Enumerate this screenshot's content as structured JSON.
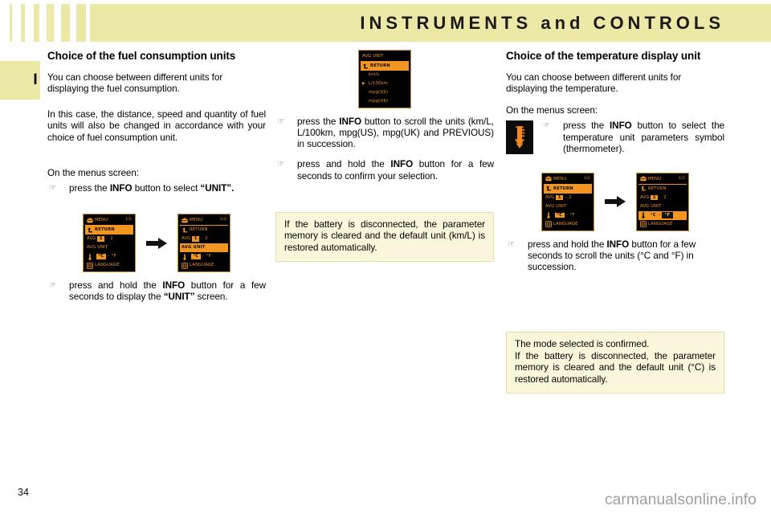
{
  "header": {
    "title": "INSTRUMENTS and CONTROLS",
    "tab_letter": "I",
    "stripe_color": "#ece8a6"
  },
  "left_column": {
    "section_title": "Choice of the fuel consumption units",
    "para_1": "You can choose between different units for displaying the fuel consumption.",
    "para_2": "In this case, the distance, speed and quantity of fuel units will also be changed in accordance with your choice of fuel consumption unit.",
    "para_3": "On the menus screen:",
    "bullet_1": {
      "hand": "☞",
      "text_before": "press the ",
      "bold_1": "INFO",
      "text_mid": " button to select ",
      "bold_2": "“UNIT”.",
      "text_after": ""
    },
    "bullet_2": {
      "hand": "☞",
      "text_before": "press and hold the ",
      "bold_1": "INFO",
      "text_mid": " button for a few seconds to display the ",
      "bold_2": "“UNIT”",
      "text_after": " screen."
    },
    "screen_a": {
      "title": "MENU",
      "page": "1/2",
      "rows": [
        {
          "label": "RETURN",
          "icon": "return-arrow-icon",
          "highlight": true
        },
        {
          "label": "AVG",
          "box": "1",
          "sep": "-",
          "after": "2",
          "highlight": false
        },
        {
          "label": "AVG UNIT",
          "highlight": false
        },
        {
          "label": "",
          "icon": "thermometer-icon",
          "box": "°C",
          "sep": "-",
          "after": "°F",
          "highlight": false
        },
        {
          "label": "LANGUAGE",
          "icon": "globe-icon",
          "highlight": false
        }
      ]
    },
    "screen_b": {
      "title": "MENU",
      "page": "1/2",
      "rows": [
        {
          "label": "RETURN",
          "icon": "return-arrow-icon",
          "highlight": false
        },
        {
          "label": "AVG",
          "box": "1",
          "sep": "-",
          "after": "2",
          "highlight": false
        },
        {
          "label": "AVG UNIT",
          "highlight": true
        },
        {
          "label": "",
          "icon": "thermometer-icon",
          "box": "°C",
          "sep": "-",
          "after": "°F",
          "highlight": false
        },
        {
          "label": "LANGUAGE",
          "icon": "globe-icon",
          "highlight": false
        }
      ]
    }
  },
  "middle_column": {
    "screen_unit": {
      "title": "AVG UNIT",
      "rows": [
        {
          "label": "RETURN",
          "icon": "return-arrow-icon",
          "highlight": true,
          "marker": false
        },
        {
          "label": "km/L",
          "highlight": false,
          "marker": false
        },
        {
          "label": "L/100km",
          "highlight": false,
          "marker": true
        },
        {
          "label": "mpg(US)",
          "highlight": false,
          "marker": false
        },
        {
          "label": "mpg(UK)",
          "highlight": false,
          "marker": false
        }
      ]
    },
    "bullet_1": {
      "hand": "☞",
      "text_before": "press the ",
      "bold_1": "INFO",
      "text_after": " button to scroll the units (km/L, L/100km, mpg(US), mpg(UK) and PREVIOUS) in succession."
    },
    "bullet_2": {
      "hand": "☞",
      "text_before": "press and hold the ",
      "bold_1": "INFO",
      "text_after": " button for a few seconds to confirm your selection."
    },
    "note": "If the battery is disconnected, the parameter memory is cleared and the default unit (km/L) is restored automatically."
  },
  "right_column": {
    "section_title": "Choice of the temperature display unit",
    "para_1": "You can choose between different units for displaying the temperature.",
    "para_2": "On the menus screen:",
    "thermo_icon": "thermometer-icon",
    "bullet_1": {
      "hand": "☞",
      "text_before": "press the ",
      "bold_1": "INFO",
      "text_after": " button to select the temperature unit parameters symbol (thermometer)."
    },
    "bullet_2": {
      "hand": "☞",
      "text_before": "press and hold the ",
      "bold_1": "INFO",
      "text_after": " button for a few seconds to scroll the units (°C and °F) in succession."
    },
    "screen_a": {
      "title": "MENU",
      "page": "1/2",
      "rows": [
        {
          "label": "RETURN",
          "icon": "return-arrow-icon",
          "highlight": true
        },
        {
          "label": "AVG",
          "box": "1",
          "sep": "-",
          "after": "2",
          "highlight": false
        },
        {
          "label": "AVG UNIT",
          "highlight": false
        },
        {
          "label": "",
          "icon": "thermometer-icon",
          "box": "°C",
          "sep": "-",
          "after": "°F",
          "highlight": false
        },
        {
          "label": "LANGUAGE",
          "icon": "globe-icon",
          "highlight": false
        }
      ]
    },
    "screen_b": {
      "title": "MENU",
      "page": "1/2",
      "rows": [
        {
          "label": "RETURN",
          "icon": "return-arrow-icon",
          "highlight": false
        },
        {
          "label": "AVG",
          "box": "1",
          "sep": "-",
          "after": "2",
          "highlight": false
        },
        {
          "label": "AVG UNIT",
          "highlight": false
        },
        {
          "label": "",
          "icon": "thermometer-icon",
          "plain": "°C",
          "sep": "-",
          "boxinv": "°F",
          "highlight": true
        },
        {
          "label": "LANGUAGE",
          "icon": "globe-icon",
          "highlight": false
        }
      ]
    },
    "note_line_1": "The mode selected is confirmed.",
    "note_line_2": "If the battery is disconnected, the parameter memory is cleared and the default unit (°C) is restored automatically."
  },
  "footer": {
    "page_number": "34",
    "watermark": "carmanualsonline.info"
  }
}
